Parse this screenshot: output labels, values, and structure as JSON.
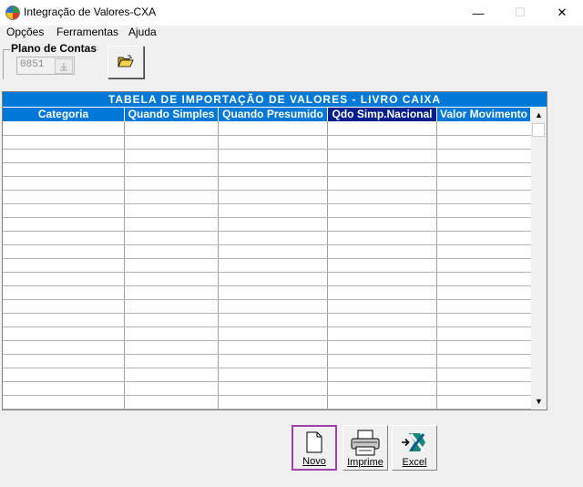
{
  "window": {
    "title": "Integração de Valores-CXA",
    "minimize": "—",
    "maximize": "☐",
    "close": "✕"
  },
  "menu": [
    {
      "label": "Opções"
    },
    {
      "label": "Ferramentas"
    },
    {
      "label": "Ajuda"
    }
  ],
  "plano": {
    "group_label": "Plano de Contas",
    "value": "0851",
    "dropdown_icon": "download-arrow-icon"
  },
  "toolbar": {
    "open_icon": "folder-open-icon"
  },
  "table": {
    "title": "TABELA  DE  IMPORTAÇÃO  DE  VALORES  -  LIVRO  CAIXA",
    "columns": [
      {
        "label": "Categoria"
      },
      {
        "label": "Quando Simples"
      },
      {
        "label": "Quando  Presumido"
      },
      {
        "label": "Qdo Simp.Nacional"
      },
      {
        "label": "Valor Movimento"
      }
    ],
    "rows": [],
    "accent_color": "#0078d7"
  },
  "buttons": {
    "novo": {
      "label": "Novo",
      "icon": "new-document-icon"
    },
    "imprime": {
      "label": "Imprime",
      "icon": "printer-icon"
    },
    "excel": {
      "label": "Excel",
      "icon": "excel-export-icon"
    }
  }
}
